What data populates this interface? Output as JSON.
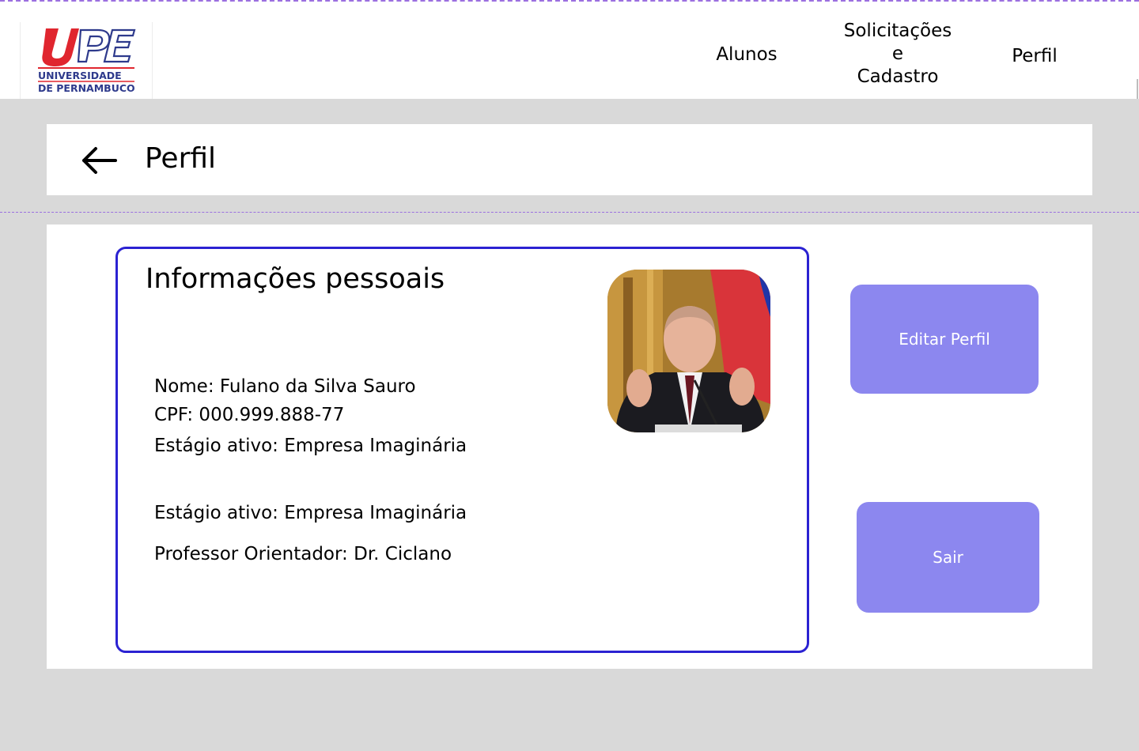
{
  "logo": {
    "mark": "UPE",
    "line1": "UNIVERSIDADE",
    "line2": "DE PERNAMBUCO"
  },
  "nav": {
    "alunos": "Alunos",
    "solicitacoes": "Solicitações\ne\nCadastro",
    "perfil": "Perfil"
  },
  "header": {
    "back_icon": "arrow-left-icon",
    "title": "Perfil"
  },
  "info": {
    "title": "Informações pessoais",
    "nome": "Nome: Fulano da Silva Sauro",
    "cpf": "CPF: 000.999.888-77",
    "estagio_1": "Estágio ativo: Empresa Imaginária",
    "estagio_2": "Estágio ativo: Empresa Imaginária",
    "professor": "Professor Orientador: Dr. Ciclano"
  },
  "actions": {
    "edit_label": "Editar Perfil",
    "logout_label": "Sair"
  },
  "colors": {
    "accent_button": "#8c87ef",
    "card_border": "#2b22d2",
    "logo_red": "#e0262f",
    "logo_blue": "#2e3a8c",
    "background": "#d9d9d9"
  }
}
